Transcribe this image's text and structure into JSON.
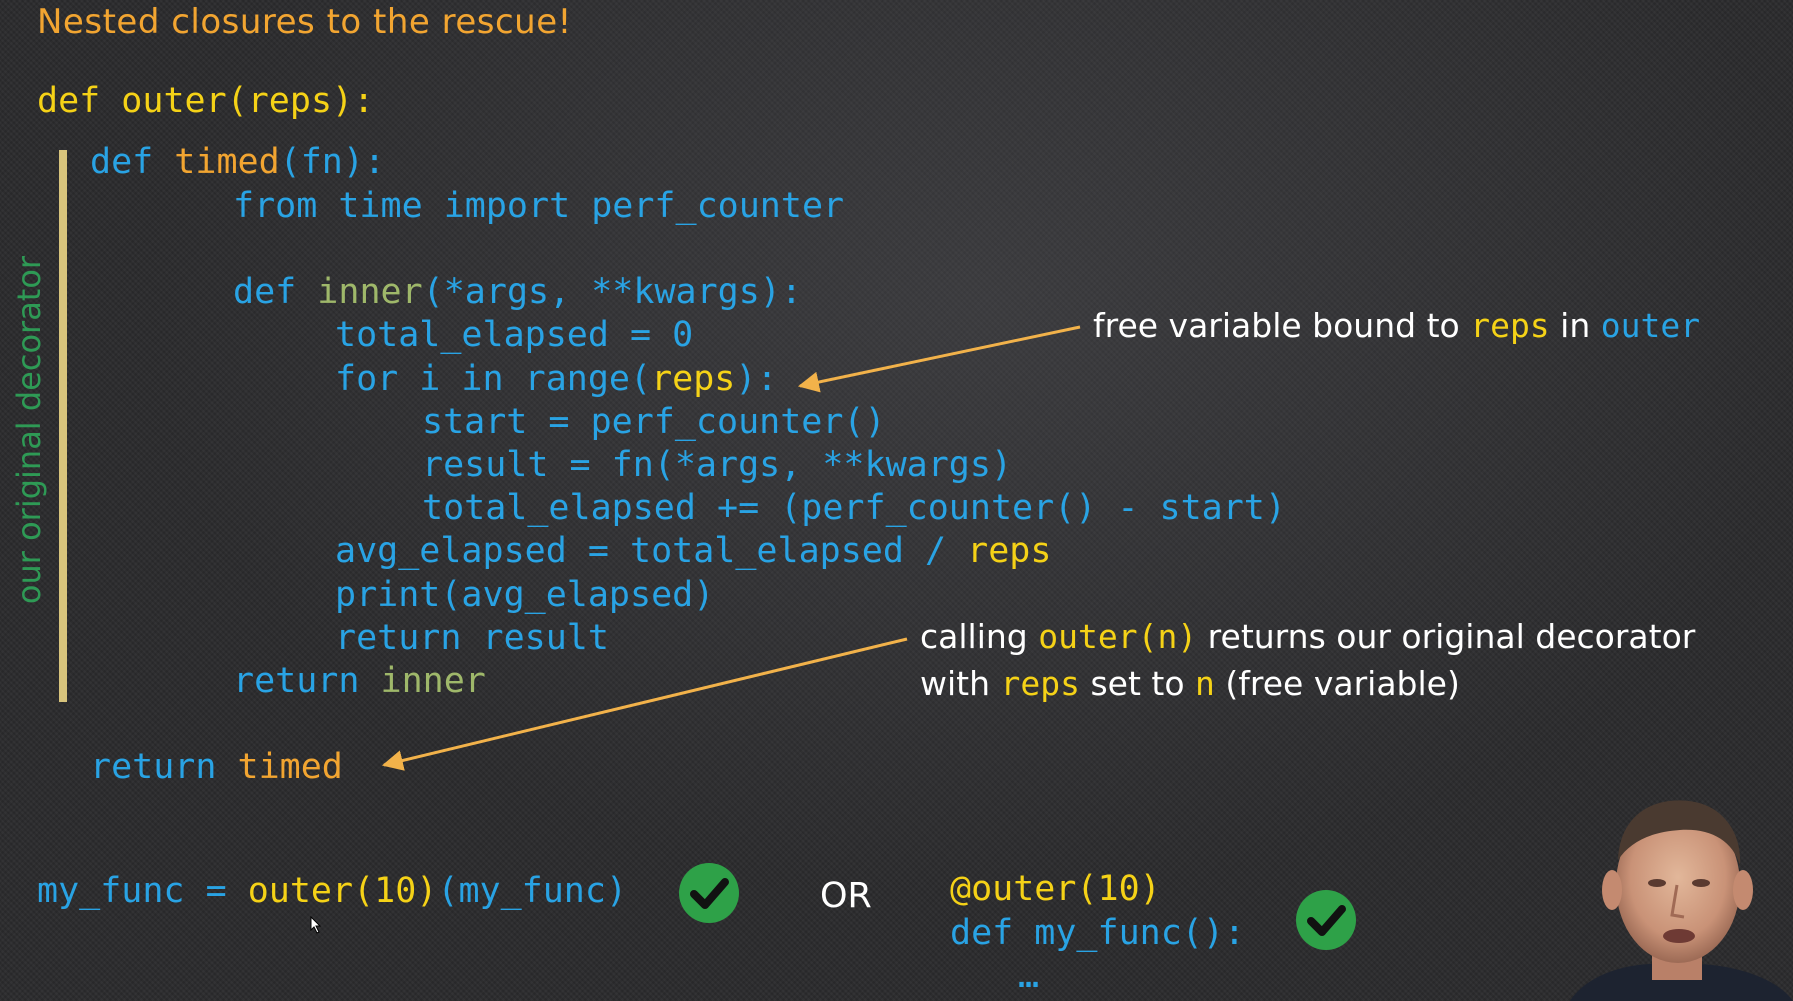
{
  "slide": {
    "title": "Nested closures to the rescue!",
    "side_label": "our original decorator"
  },
  "code": {
    "l1_def": "def ",
    "l1_sig": "outer(reps):",
    "l2_def": "def ",
    "l2_name": "timed",
    "l2_rest": "(fn):",
    "l3": "from time import perf_counter",
    "l4_def": "def ",
    "l4_name": "inner",
    "l4_rest": "(*args, **kwargs):",
    "l5": "total_elapsed = 0",
    "l6_a": "for i in range(",
    "l6_reps": "reps",
    "l6_b": "):",
    "l7": "start = perf_counter()",
    "l8": "result = fn(*args, **kwargs)",
    "l9": "total_elapsed += (perf_counter() - start)",
    "l10_a": "avg_elapsed = total_elapsed / ",
    "l10_reps": "reps",
    "l11": "print(avg_elapsed)",
    "l12": "return result",
    "l13_ret": "return ",
    "l13_name": "inner",
    "l14_ret": "return ",
    "l14_name": "timed"
  },
  "annotations": {
    "a1_pre": "free variable bound to ",
    "a1_reps": "reps",
    "a1_mid": " in ",
    "a1_outer": "outer",
    "a2_pre": "calling ",
    "a2_call": "outer(n)",
    "a2_post": " returns our original decorator",
    "a3_pre": "with ",
    "a3_reps": "reps",
    "a3_mid": " set to ",
    "a3_n": "n",
    "a3_post": " (free variable)"
  },
  "usage": {
    "left_var": "my_func = ",
    "left_call": "outer(10)",
    "left_rest": "(my_func)",
    "or_label": "OR",
    "dec_line": "@outer(10)",
    "def_line": "def my_func():",
    "ellipsis": "…"
  },
  "colors": {
    "keyword_yellow": "#f5d217",
    "code_blue": "#29a3e4",
    "inner_green": "#9fb86a",
    "title_orange": "#f2a531",
    "check_green": "#2ea148",
    "arrow": "#f2b24a"
  },
  "icons": [
    "checkmark-icon",
    "checkmark-icon",
    "mouse-cursor-icon",
    "arrow-icon",
    "arrow-icon"
  ]
}
